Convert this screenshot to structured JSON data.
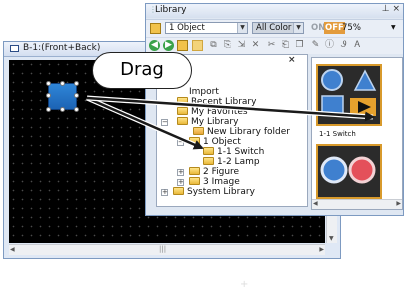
{
  "screen_window": {
    "title": "B-1:(Front+Back)"
  },
  "library_window": {
    "title": "Library",
    "object_dropdown": "1 Object",
    "color_dropdown": "All Color",
    "toggle_on": "ON",
    "toggle_off": "OFF",
    "zoom_value": "75%"
  },
  "tree": {
    "items": [
      {
        "label": "Import"
      },
      {
        "label": "Recent Library"
      },
      {
        "label": "My Favorites"
      },
      {
        "label": "My Library"
      },
      {
        "label": "New Library folder"
      },
      {
        "label": "1 Object"
      },
      {
        "label": "1-1 Switch"
      },
      {
        "label": "1-2 Lamp"
      },
      {
        "label": "2 Figure"
      },
      {
        "label": "3 Image"
      },
      {
        "label": "System Library"
      }
    ]
  },
  "preview": {
    "label": "1-1 Switch"
  },
  "callout": {
    "text": "Drag"
  },
  "colors": {
    "arrow": "#1a1a1a",
    "accent_orange": "#d89a2c",
    "folder_yellow": "#f5c842",
    "switch_blue": "#1f6fc4",
    "canvas_black": "#000000"
  }
}
